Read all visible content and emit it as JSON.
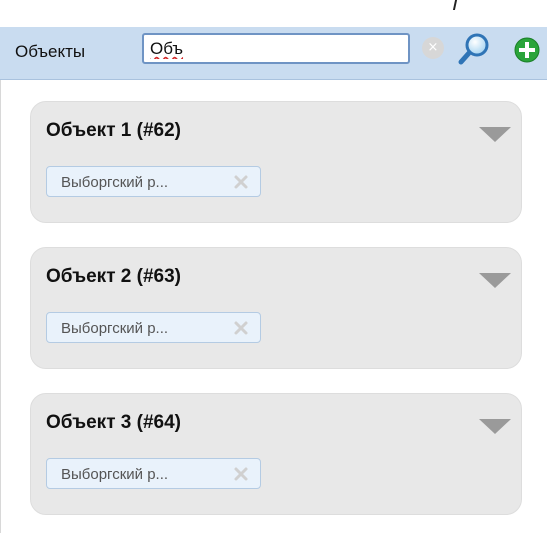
{
  "header": {
    "title": "Объекты",
    "search_value": "Объ",
    "clear_icon": "×"
  },
  "objects": [
    {
      "title": "Объект 1 (#62)",
      "tag": "Выборгский р..."
    },
    {
      "title": "Объект 2 (#63)",
      "tag": "Выборгский р..."
    },
    {
      "title": "Объект 3 (#64)",
      "tag": "Выборгский р..."
    }
  ],
  "icons": {
    "search": "magnifier-icon",
    "add": "plus-circle-icon",
    "clear": "clear-circle-icon",
    "toggle": "triangle-down-icon",
    "tag_remove": "x-icon"
  },
  "colors": {
    "header_bg": "#c9dcf0",
    "card_bg": "#e8e8e8",
    "tag_bg": "#e9f2fb",
    "add_green": "#2aa43a"
  }
}
